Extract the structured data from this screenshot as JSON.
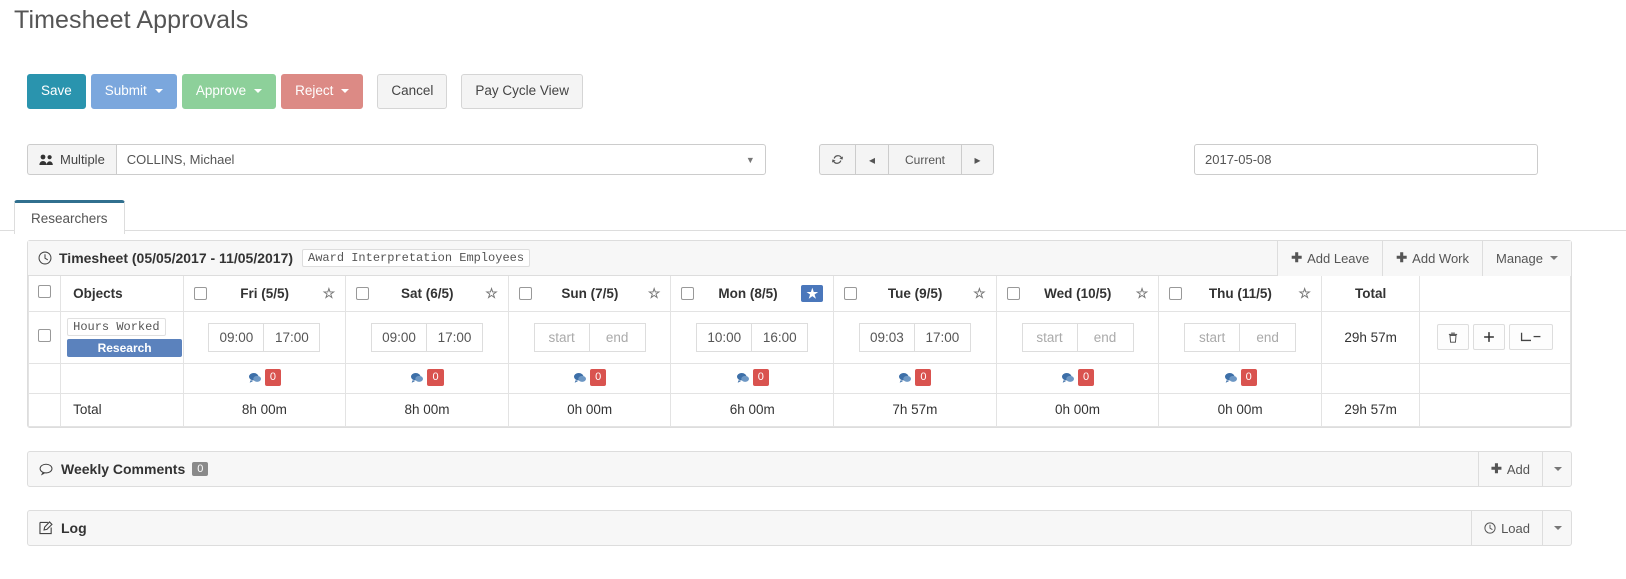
{
  "page": {
    "title": "Timesheet Approvals"
  },
  "toolbar": {
    "save": "Save",
    "submit": "Submit",
    "approve": "Approve",
    "reject": "Reject",
    "cancel": "Cancel",
    "pay_cycle_view": "Pay Cycle View"
  },
  "selector": {
    "multiple_label": "Multiple",
    "employee": "COLLINS, Michael",
    "employee_placeholder": "COLLINS, Michael"
  },
  "navigation": {
    "refresh_icon": "refresh-icon",
    "prev": "◂",
    "current": "Current",
    "next": "▸",
    "date": "2017-05-08"
  },
  "tabs": [
    {
      "label": "Researchers",
      "active": true
    }
  ],
  "timesheet": {
    "heading": "Timesheet (05/05/2017 - 11/05/2017)",
    "award_tag": "Award Interpretation Employees",
    "add_leave": "Add Leave",
    "add_work": "Add Work",
    "manage": "Manage",
    "columns": {
      "objects": "Objects",
      "total": "Total",
      "total_row_label": "Total"
    },
    "days": [
      {
        "label": "Fri (5/5)",
        "starred": false
      },
      {
        "label": "Sat (6/5)",
        "starred": false
      },
      {
        "label": "Sun (7/5)",
        "starred": false
      },
      {
        "label": "Mon (8/5)",
        "starred": true
      },
      {
        "label": "Tue (9/5)",
        "starred": false
      },
      {
        "label": "Wed (10/5)",
        "starred": false
      },
      {
        "label": "Thu (11/5)",
        "starred": false
      }
    ],
    "row": {
      "object_label": "Hours Worked",
      "object_badge": "Research",
      "row_total": "29h 57m",
      "entries": [
        {
          "start": "09:00",
          "end": "17:00",
          "empty": false
        },
        {
          "start": "09:00",
          "end": "17:00",
          "empty": false
        },
        {
          "start": "start",
          "end": "end",
          "empty": true
        },
        {
          "start": "10:00",
          "end": "16:00",
          "empty": false
        },
        {
          "start": "09:03",
          "end": "17:00",
          "empty": false
        },
        {
          "start": "start",
          "end": "end",
          "empty": true
        },
        {
          "start": "start",
          "end": "end",
          "empty": true
        }
      ]
    },
    "comment_counts": [
      "0",
      "0",
      "0",
      "0",
      "0",
      "0",
      "0"
    ],
    "totals": [
      "8h 00m",
      "8h 00m",
      "0h 00m",
      "6h 00m",
      "7h 57m",
      "0h 00m",
      "0h 00m"
    ],
    "grand_total": "29h 57m",
    "actions": {
      "delete_icon": "trash-icon",
      "add_icon": "plus-icon",
      "split_icon": "split-row-icon"
    }
  },
  "weekly_comments": {
    "title": "Weekly Comments",
    "count": "0",
    "add": "Add"
  },
  "log": {
    "title": "Log",
    "load": "Load"
  },
  "colors": {
    "save": "#2a94ae",
    "submit": "#7ba7dd",
    "approve": "#8dd09a",
    "reject": "#dc8a85",
    "badge_blue": "#5b82bd",
    "star_active": "#4a77bb",
    "comment_badge": "#d9534f",
    "tab_active": "#31708f"
  }
}
